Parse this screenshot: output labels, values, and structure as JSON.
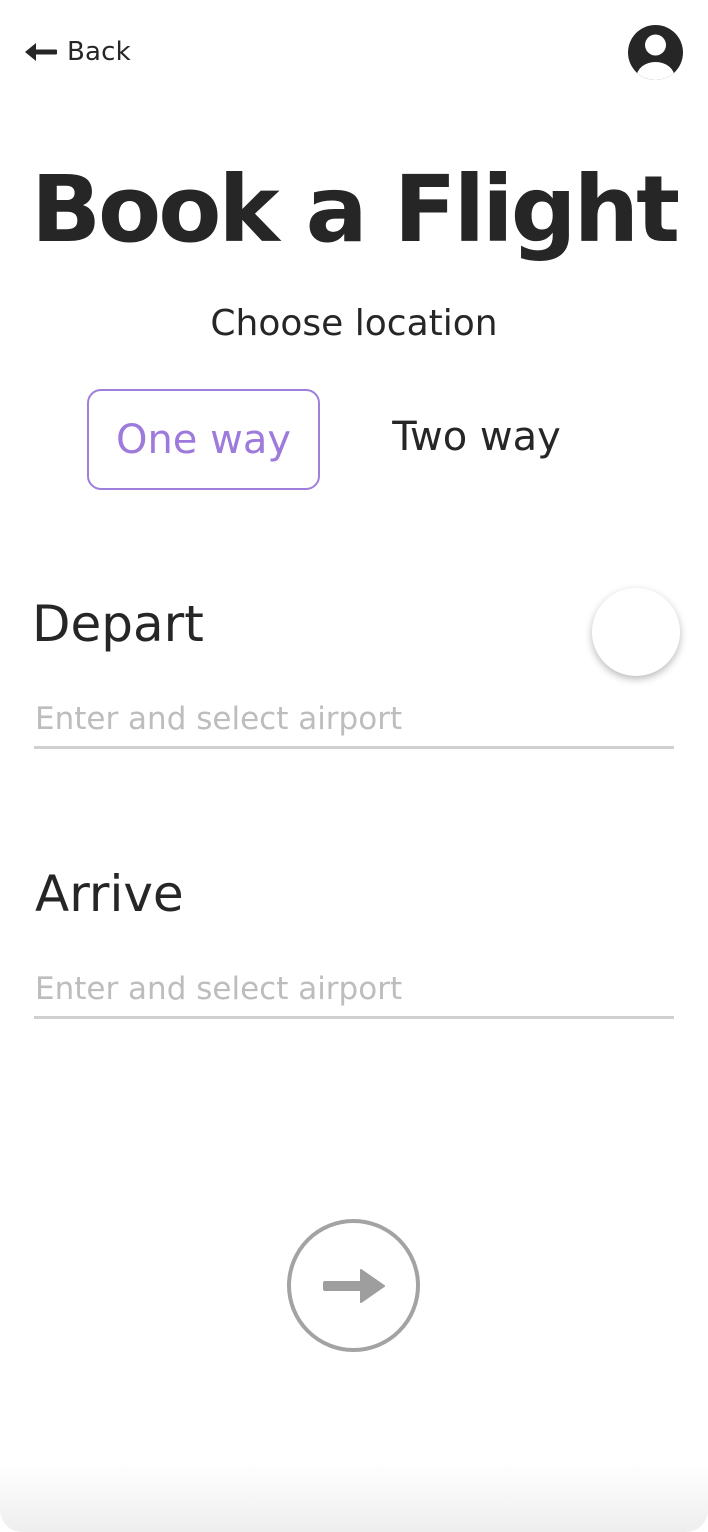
{
  "header": {
    "back_label": "Back",
    "back_icon": "arrow-left-icon",
    "profile_icon": "user-circle-icon"
  },
  "main": {
    "title": "Book a Flight",
    "subtitle": "Choose location",
    "tabs": [
      {
        "label": "One way",
        "selected": true
      },
      {
        "label": "Two way",
        "selected": false
      }
    ],
    "depart": {
      "label": "Depart",
      "value": "",
      "placeholder": "Enter and select airport"
    },
    "arrive": {
      "label": "Arrive",
      "value": "",
      "placeholder": "Enter and select airport"
    },
    "next_icon": "arrow-right-icon"
  },
  "colors": {
    "accent": "#9d7adb",
    "text": "#262626",
    "placeholder": "#bdbdbd",
    "underline": "#d0d0d0",
    "next_button": "#a3a3a3"
  }
}
